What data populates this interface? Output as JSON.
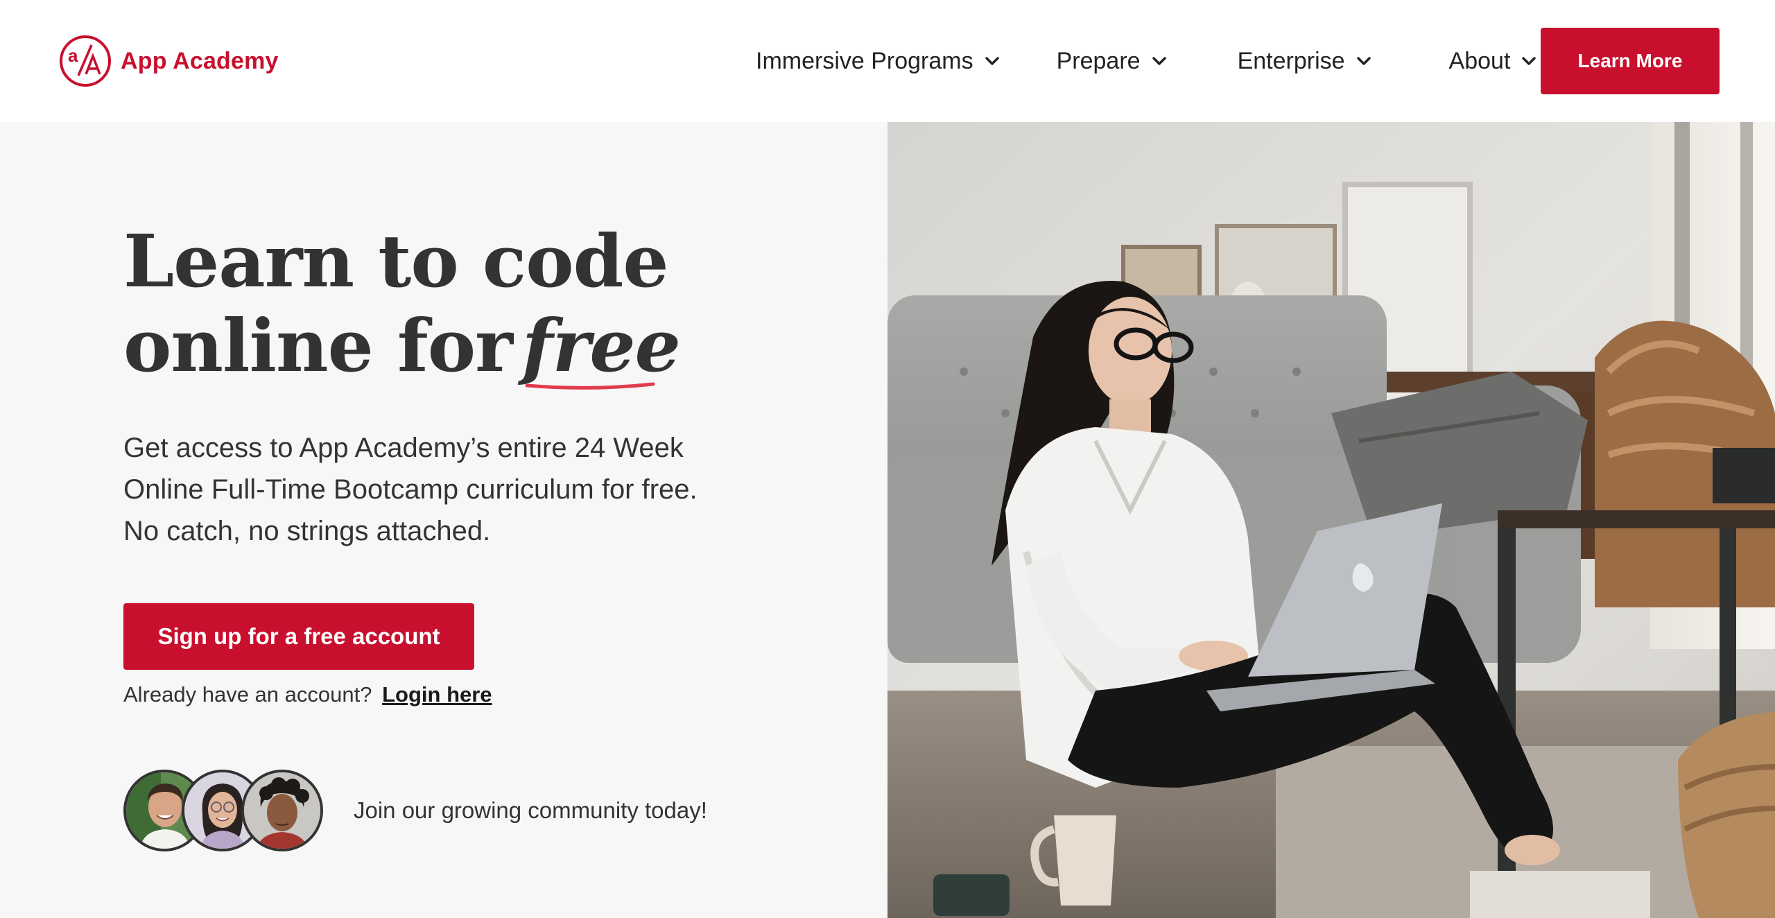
{
  "header": {
    "logo_text": "App Academy",
    "nav": [
      {
        "label": "Immersive Programs",
        "icon": "chevron-down-icon"
      },
      {
        "label": "Prepare",
        "icon": "chevron-down-icon"
      },
      {
        "label": "Enterprise",
        "icon": "chevron-down-icon"
      },
      {
        "label": "About",
        "icon": "chevron-down-icon"
      }
    ],
    "cta_label": "Learn More"
  },
  "hero": {
    "headline_line1": "Learn to code",
    "headline_line2_prefix": "online for",
    "headline_emphasis": "free",
    "subcopy_lines": [
      "Get access to App Academy’s entire 24 Week",
      "Online Full-Time Bootcamp curriculum for free.",
      "No catch, no strings attached."
    ],
    "signup_label": "Sign up for a free account",
    "login_prompt": "Already have an account?",
    "login_link": "Login here",
    "community_text": "Join our growing community today!"
  },
  "colors": {
    "brand_red": "#c8102e",
    "left_panel_bg": "#f7f7f7",
    "text_dark": "#333333"
  }
}
